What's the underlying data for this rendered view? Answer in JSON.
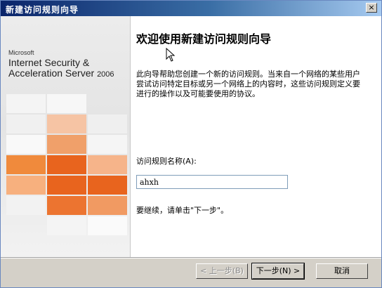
{
  "window": {
    "title": "新建访问规则向导",
    "close_label": "×"
  },
  "branding": {
    "company": "Microsoft",
    "line1": "Internet Security &",
    "line2": "Acceleration Server",
    "year": "2006"
  },
  "content": {
    "heading": "欢迎使用新建访问规则向导",
    "description": "此向导帮助您创建一个新的访问规则。当来自一个网络的某些用户尝试访问特定目标或另一个网络上的内容时，这些访问规则定义要进行的操作以及可能要使用的协议。",
    "name_label": "访问规则名称(A):",
    "name_value": "ahxh",
    "hint": "要继续，请单击\"下一步\"。"
  },
  "buttons": {
    "back": "< 上一步(B)",
    "next": "下一步(N) >",
    "cancel": "取消"
  },
  "colors": {
    "orange_dark": "#e8641e",
    "orange_mid": "#f08a3c",
    "orange_light": "#f6b48a",
    "title_bar_start": "#0a246a"
  }
}
